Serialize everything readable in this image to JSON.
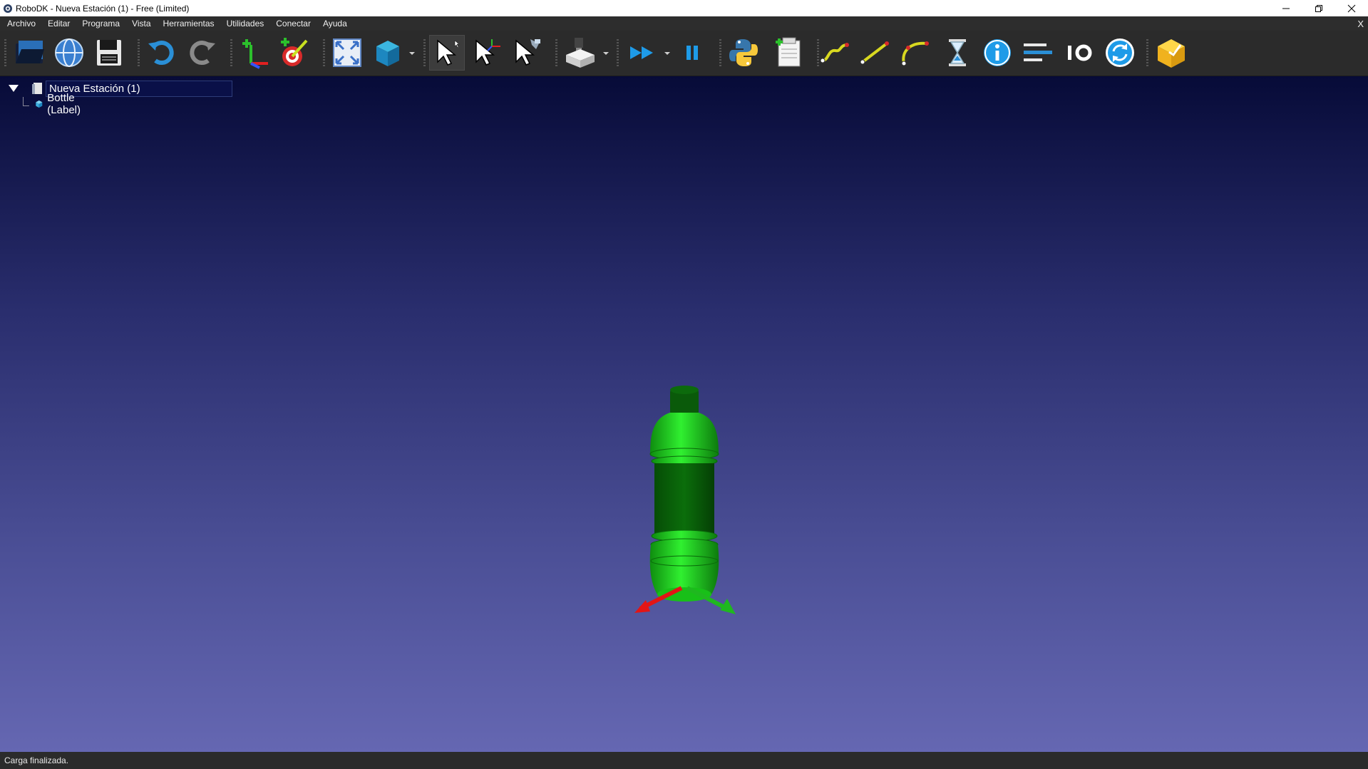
{
  "window": {
    "title": "RoboDK - Nueva Estación (1) - Free (Limited)",
    "app_icon": "robodk-logo-icon",
    "controls": [
      "minimize-icon",
      "restore-icon",
      "close-icon"
    ]
  },
  "menu": {
    "items": [
      "Archivo",
      "Editar",
      "Programa",
      "Vista",
      "Herramientas",
      "Utilidades",
      "Conectar",
      "Ayuda"
    ],
    "close_label": "X"
  },
  "toolbar": {
    "icons": [
      "open-folder-icon",
      "online-library-globe-icon",
      "save-disk-icon",
      "undo-icon",
      "redo-icon",
      "add-reference-frame-icon",
      "add-target-icon",
      "fit-all-icon",
      "view-cube-icon",
      "select-icon",
      "move-reference-icon",
      "move-tool-icon",
      "new-program-icon",
      "run-program-icon",
      "pause-icon",
      "python-program-icon",
      "teach-target-icon",
      "move-joint-icon",
      "move-linear-icon",
      "move-circular-icon",
      "pause-instruction-icon",
      "message-icon",
      "program-call-icon",
      "io-icon",
      "synchronize-icon",
      "export-package-icon"
    ]
  },
  "tree": {
    "root_label": "Nueva Estación (1)",
    "child_label": "Bottle (Label)"
  },
  "scene": {
    "object": "bottle",
    "bottle_color": "#19d419",
    "x_axis_color": "#e31515",
    "y_axis_color": "#1fb81f"
  },
  "status": {
    "text": "Carga finalizada."
  },
  "colors": {
    "viewport_top": "#070b38",
    "viewport_bottom": "#6567b2",
    "toolbar_bg": "#2b2b2b"
  }
}
